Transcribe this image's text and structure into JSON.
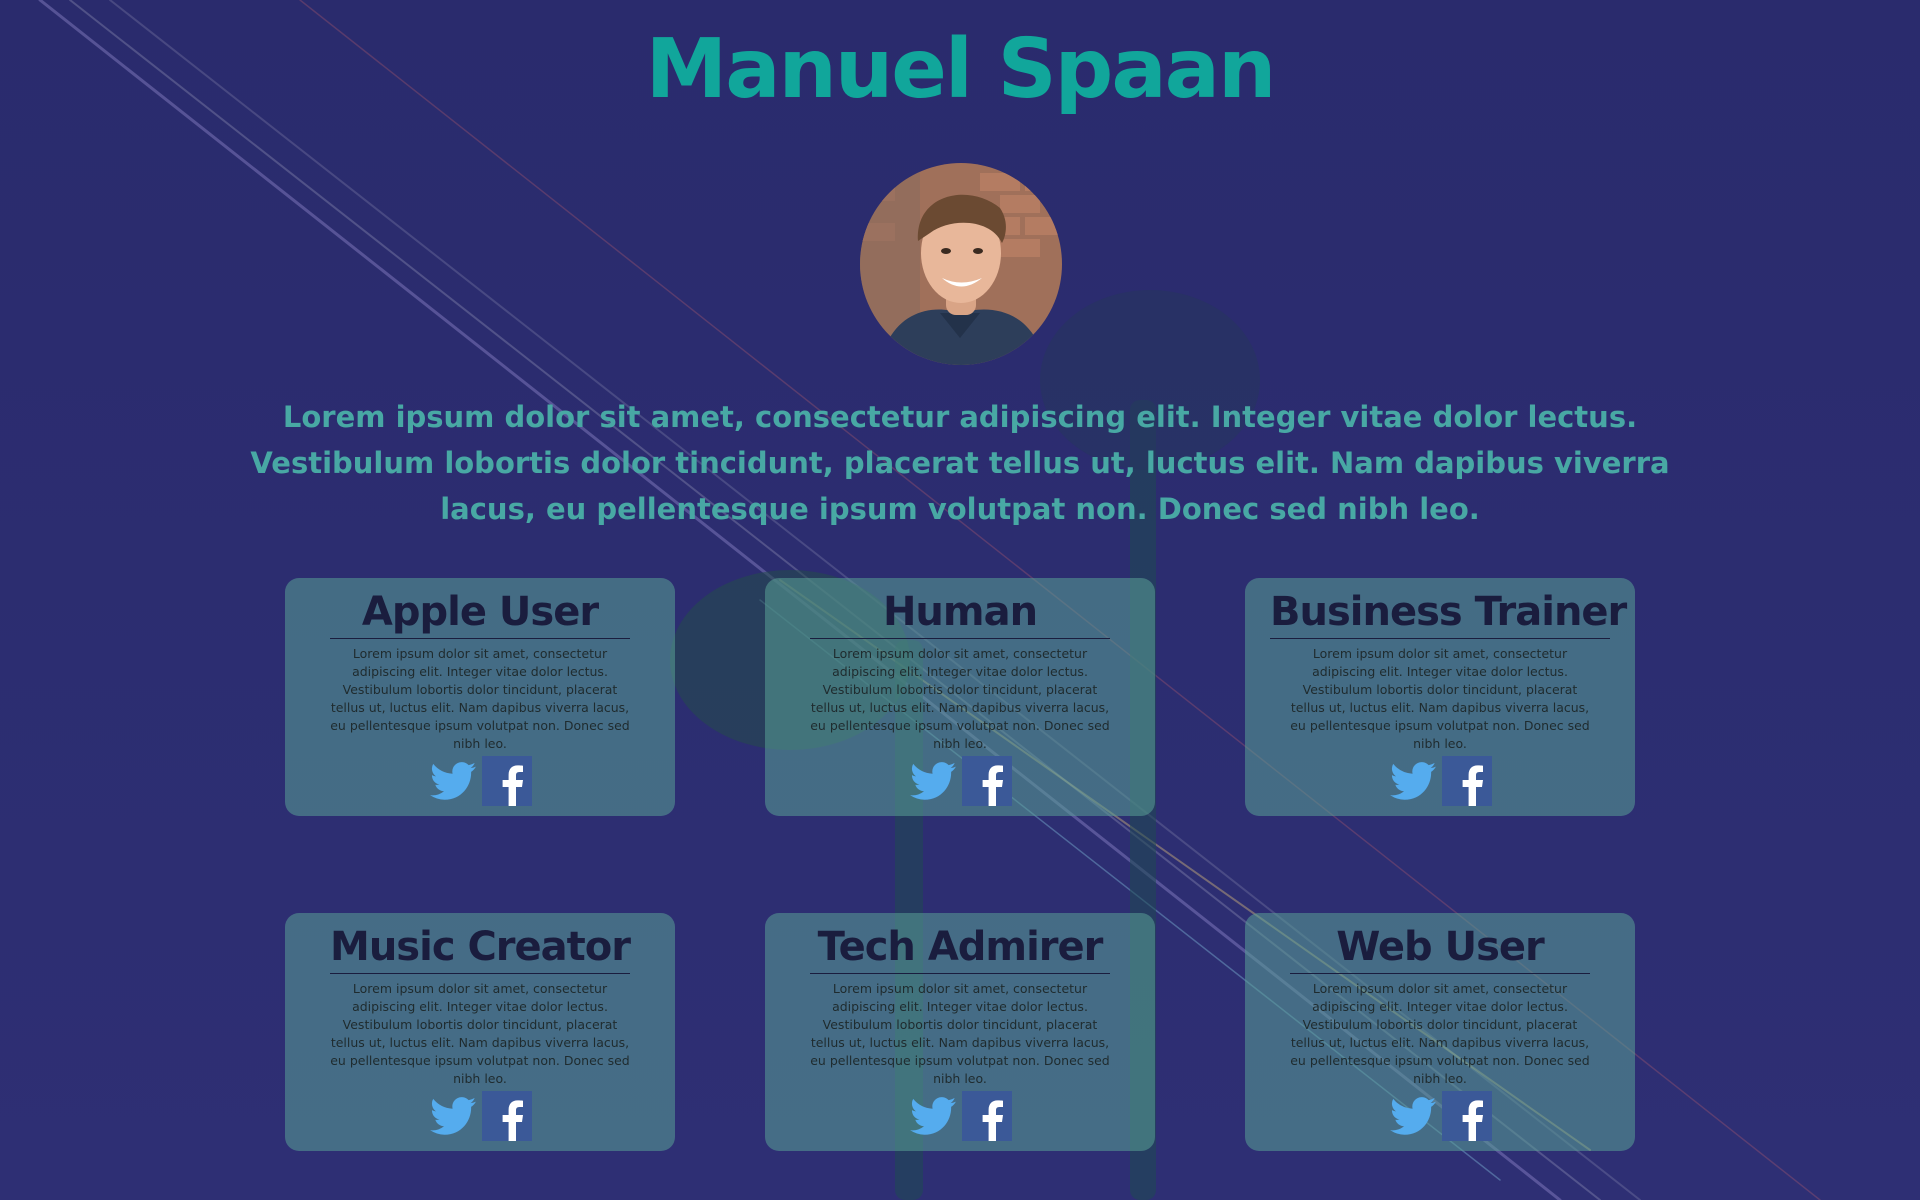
{
  "profile": {
    "name": "Manuel Spaan",
    "bio": "Lorem ipsum dolor sit amet, consectetur adipiscing elit. Integer vitae dolor lectus. Vestibulum lobortis dolor tincidunt, placerat tellus ut, luctus elit. Nam dapibus viverra lacus, eu pellentesque ipsum volutpat non. Donec sed nibh leo."
  },
  "cards": [
    {
      "title": "Apple User",
      "text": "Lorem ipsum dolor sit amet, consectetur adipiscing elit. Integer vitae dolor lectus. Vestibulum lobortis dolor tincidunt, placerat tellus ut, luctus elit. Nam dapibus viverra lacus, eu pellentesque ipsum volutpat non. Donec sed nibh leo."
    },
    {
      "title": "Human",
      "text": "Lorem ipsum dolor sit amet, consectetur adipiscing elit. Integer vitae dolor lectus. Vestibulum lobortis dolor tincidunt, placerat tellus ut, luctus elit. Nam dapibus viverra lacus, eu pellentesque ipsum volutpat non. Donec sed nibh leo."
    },
    {
      "title": "Business Trainer",
      "text": "Lorem ipsum dolor sit amet, consectetur adipiscing elit. Integer vitae dolor lectus. Vestibulum lobortis dolor tincidunt, placerat tellus ut, luctus elit. Nam dapibus viverra lacus, eu pellentesque ipsum volutpat non. Donec sed nibh leo."
    },
    {
      "title": "Music Creator",
      "text": "Lorem ipsum dolor sit amet, consectetur adipiscing elit. Integer vitae dolor lectus. Vestibulum lobortis dolor tincidunt, placerat tellus ut, luctus elit. Nam dapibus viverra lacus, eu pellentesque ipsum volutpat non. Donec sed nibh leo."
    },
    {
      "title": "Tech Admirer",
      "text": "Lorem ipsum dolor sit amet, consectetur adipiscing elit. Integer vitae dolor lectus. Vestibulum lobortis dolor tincidunt, placerat tellus ut, luctus elit. Nam dapibus viverra lacus, eu pellentesque ipsum volutpat non. Donec sed nibh leo."
    },
    {
      "title": "Web User",
      "text": "Lorem ipsum dolor sit amet, consectetur adipiscing elit. Integer vitae dolor lectus. Vestibulum lobortis dolor tincidunt, placerat tellus ut, luctus elit. Nam dapibus viverra lacus, eu pellentesque ipsum volutpat non. Donec sed nibh leo."
    }
  ],
  "icons": {
    "twitter": "twitter-icon",
    "facebook": "facebook-icon"
  },
  "colors": {
    "background": "#2b2c6e",
    "title": "#11a69b",
    "bio": "#48a8a4",
    "card": "#5aa096",
    "card_title": "#1a1d3e",
    "twitter": "#55acee",
    "facebook": "#3b5998"
  }
}
